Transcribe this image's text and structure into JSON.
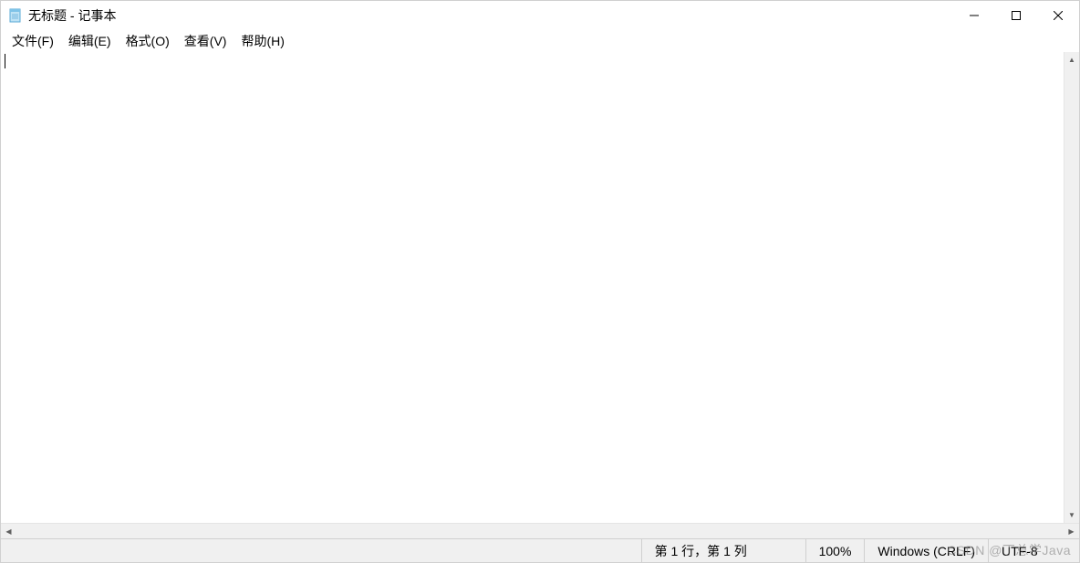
{
  "titlebar": {
    "title": "无标题 - 记事本"
  },
  "menubar": {
    "items": [
      {
        "label": "文件(F)"
      },
      {
        "label": "编辑(E)"
      },
      {
        "label": "格式(O)"
      },
      {
        "label": "查看(V)"
      },
      {
        "label": "帮助(H)"
      }
    ]
  },
  "editor": {
    "content": ""
  },
  "statusbar": {
    "position": "第 1 行，第 1 列",
    "zoom": "100%",
    "line_ending": "Windows (CRLF)",
    "encoding": "UTF-8"
  },
  "watermark": "CSDN @丁总学Java"
}
